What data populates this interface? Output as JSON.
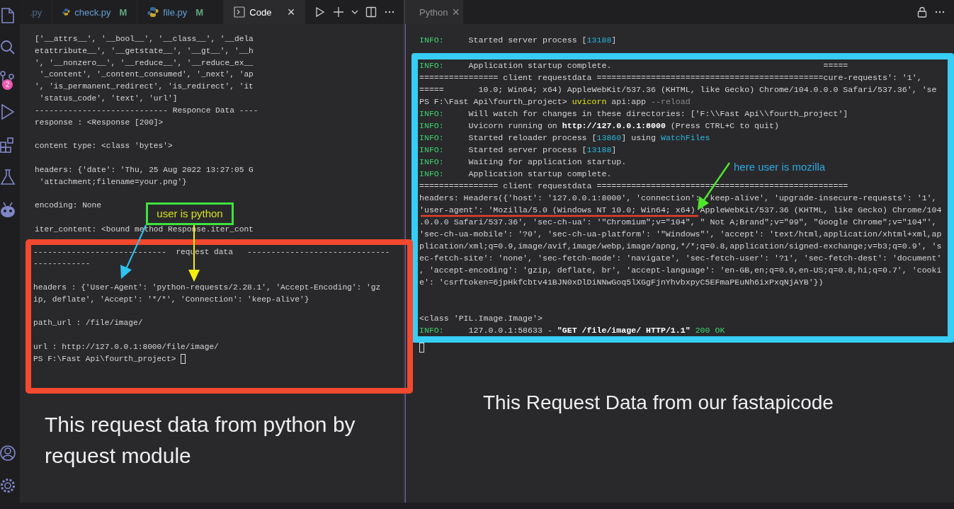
{
  "activity_bar": {
    "badge": "2"
  },
  "left_tabs": [
    {
      "label": ".py",
      "kind": "plain",
      "selected": false
    },
    {
      "label": "check.py",
      "kind": "file",
      "badge": "M",
      "selected": false
    },
    {
      "label": "file.py",
      "kind": "file",
      "badge": "M",
      "selected": false
    },
    {
      "label": "Code",
      "kind": "terminal",
      "close": "×",
      "selected": true
    }
  ],
  "left_lines": [
    {
      "kind": "text",
      "text": "['__attrs__', '__bool__', '__class__', '__dela"
    },
    {
      "kind": "text",
      "text": "etattribute__', '__getstate__', '__gt__', '__h"
    },
    {
      "kind": "text",
      "text": "', '__nonzero__', '__reduce__', '__reduce_ex__"
    },
    {
      "kind": "text",
      "text": " '_content', '_content_consumed', '_next', 'ap"
    },
    {
      "kind": "text",
      "text": "', 'is_permanent_redirect', 'is_redirect', 'it"
    },
    {
      "kind": "text",
      "text": " 'status_code', 'text', 'url']"
    },
    {
      "kind": "text",
      "text": "---------------------------- Responce Data ----"
    },
    {
      "kind": "text",
      "text": "response : <Response [200]>"
    },
    {
      "kind": "blank"
    },
    {
      "kind": "text",
      "text": "content type: <class 'bytes'>"
    },
    {
      "kind": "blank"
    },
    {
      "kind": "text",
      "text": "headers: {'date': 'Thu, 25 Aug 2022 13:27:05 G"
    },
    {
      "kind": "text",
      "text": " 'attachment;filename=your.png'}"
    },
    {
      "kind": "blank"
    },
    {
      "kind": "text",
      "text": "encoding: None"
    },
    {
      "kind": "blank"
    },
    {
      "kind": "text",
      "text": "iter_content: <bound method Response.iter_cont"
    }
  ],
  "left_boxed_lines": [
    {
      "kind": "text",
      "text": "----------------------------  request data   ------------------------------"
    },
    {
      "kind": "text",
      "text": "------------"
    },
    {
      "kind": "blank"
    },
    {
      "kind": "text",
      "text": "headers : {'User-Agent': 'python-requests/2.28.1', 'Accept-Encoding': 'gz"
    },
    {
      "kind": "text",
      "text": "ip, deflate', 'Accept': '*/*', 'Connection': 'keep-alive'}"
    },
    {
      "kind": "blank"
    },
    {
      "kind": "text",
      "text": "path_url : /file/image/"
    },
    {
      "kind": "blank"
    },
    {
      "kind": "text",
      "text": "url : http://127.0.0.1:8000/file/image/"
    },
    {
      "kind": "prompt",
      "text": "PS F:\\Fast Api\\fourth_project>"
    }
  ],
  "left_caption": "This request data from python by request module",
  "python_note": "user is python",
  "right_tabs": [
    {
      "label": "Python",
      "kind": "terminal",
      "close": "×",
      "selected": true
    }
  ],
  "right_lines": [
    {
      "kind": "mixed",
      "segments": [
        {
          "text": "INFO:",
          "kind": "info"
        },
        {
          "text": "     Started server process ["
        },
        {
          "text": "13188",
          "kind": "num"
        },
        {
          "text": "]"
        }
      ]
    }
  ],
  "right_boxed_lines": [
    {
      "kind": "mixed",
      "segments": [
        {
          "text": "INFO:",
          "kind": "info"
        },
        {
          "text": "     Application startup complete.                                           ====="
        }
      ]
    },
    {
      "kind": "text",
      "text": "================ client requestdata ==============================================cure-requests': '1',"
    },
    {
      "kind": "text",
      "text": "=====       10.0; Win64; x64) AppleWebKit/537.36 (KHTML, like Gecko) Chrome/104.0.0.0 Safari/537.36', 'se"
    },
    {
      "kind": "mixed",
      "segments": [
        {
          "text": "PS F:\\Fast Api\\fourth_project> "
        },
        {
          "text": "uvicorn",
          "kind": "cmd"
        },
        {
          "text": " api:app "
        },
        {
          "text": "--reload",
          "kind": "flag"
        }
      ]
    },
    {
      "kind": "mixed",
      "segments": [
        {
          "text": "INFO:",
          "kind": "info"
        },
        {
          "text": "     Will watch for changes in these directories: ['F:\\\\Fast Api\\\\fourth_project']"
        }
      ]
    },
    {
      "kind": "mixed",
      "segments": [
        {
          "text": "INFO:",
          "kind": "info"
        },
        {
          "text": "     Uvicorn running on "
        },
        {
          "text": "http://127.0.0.1:8000",
          "kind": "bold"
        },
        {
          "text": " (Press CTRL+C to quit)"
        }
      ]
    },
    {
      "kind": "mixed",
      "segments": [
        {
          "text": "INFO:",
          "kind": "info"
        },
        {
          "text": "     Started reloader process ["
        },
        {
          "text": "13860",
          "kind": "num"
        },
        {
          "text": "] using "
        },
        {
          "text": "WatchFiles",
          "kind": "num"
        }
      ]
    },
    {
      "kind": "mixed",
      "segments": [
        {
          "text": "INFO:",
          "kind": "info"
        },
        {
          "text": "     Started server process ["
        },
        {
          "text": "13188",
          "kind": "num"
        },
        {
          "text": "]"
        }
      ]
    },
    {
      "kind": "mixed",
      "segments": [
        {
          "text": "INFO:",
          "kind": "info"
        },
        {
          "text": "     Waiting for application startup."
        }
      ]
    },
    {
      "kind": "mixed",
      "segments": [
        {
          "text": "INFO:",
          "kind": "info"
        },
        {
          "text": "     Application startup complete."
        }
      ]
    },
    {
      "kind": "text",
      "text": "================ client requestdata ==================================================="
    },
    {
      "kind": "text",
      "text": "headers: Headers({'host': '127.0.0.1:8000', 'connection': 'keep-alive', 'upgrade-insecure-requests': '1',"
    },
    {
      "kind": "text",
      "text": "'user-agent': 'Mozilla/5.0 (Windows NT 10.0; Win64; x64) AppleWebKit/537.36 (KHTML, like Gecko) Chrome/104"
    },
    {
      "kind": "text",
      "text": ".0.0.0 Safari/537.36', 'sec-ch-ua': '\"Chromium\";v=\"104\", \" Not A;Brand\";v=\"99\", \"Google Chrome\";v=\"104\"',"
    },
    {
      "kind": "text",
      "text": "'sec-ch-ua-mobile': '?0', 'sec-ch-ua-platform': '\"Windows\"', 'accept': 'text/html,application/xhtml+xml,ap"
    },
    {
      "kind": "text",
      "text": "plication/xml;q=0.9,image/avif,image/webp,image/apng,*/*;q=0.8,application/signed-exchange;v=b3;q=0.9', 's"
    },
    {
      "kind": "text",
      "text": "ec-fetch-site': 'none', 'sec-fetch-mode': 'navigate', 'sec-fetch-user': '?1', 'sec-fetch-dest': 'document'"
    },
    {
      "kind": "text",
      "text": ", 'accept-encoding': 'gzip, deflate, br', 'accept-language': 'en-GB,en;q=0.9,en-US;q=0.8,hi;q=0.7', 'cooki"
    },
    {
      "kind": "text",
      "text": "e': 'csrftoken=6jpHkfcbtv41BJN0xDlDiNNwGoq5lXGgFjnYhvbxpyC5EFmaPEuNh6ixPxqNjAYB'})"
    },
    {
      "kind": "blank"
    },
    {
      "kind": "blank"
    },
    {
      "kind": "text",
      "text": "<class 'PIL.Image.Image'>"
    },
    {
      "kind": "mixed",
      "segments": [
        {
          "text": "INFO:",
          "kind": "info"
        },
        {
          "text": "     127.0.0.1:58633 - "
        },
        {
          "text": "\"GET /file/image/ HTTP/1.1\"",
          "kind": "bold"
        },
        {
          "text": "200 OK",
          "kind": "ok"
        }
      ]
    }
  ],
  "right_after_lines": [
    {
      "kind": "cursor"
    }
  ],
  "mozilla_note": "here user is mozilla",
  "right_caption": "This Request Data from our fastapicode"
}
